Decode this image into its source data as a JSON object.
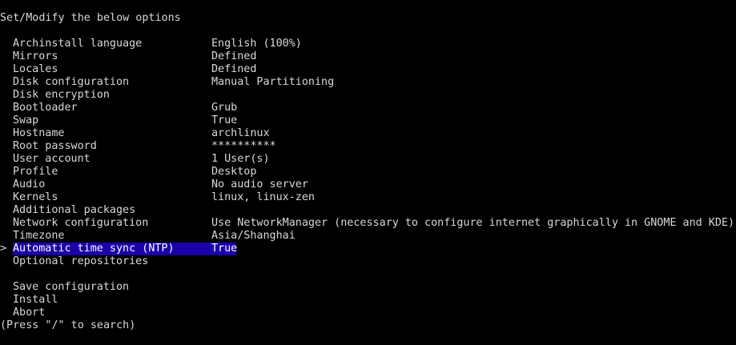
{
  "prompt": "Set/Modify the below options",
  "cursor_symbol": ">",
  "options": [
    {
      "label": "Archinstall language",
      "value": "English (100%)"
    },
    {
      "label": "Mirrors",
      "value": "Defined"
    },
    {
      "label": "Locales",
      "value": "Defined"
    },
    {
      "label": "Disk configuration",
      "value": "Manual Partitioning"
    },
    {
      "label": "Disk encryption",
      "value": ""
    },
    {
      "label": "Bootloader",
      "value": "Grub"
    },
    {
      "label": "Swap",
      "value": "True"
    },
    {
      "label": "Hostname",
      "value": "archlinux"
    },
    {
      "label": "Root password",
      "value": "**********"
    },
    {
      "label": "User account",
      "value": "1 User(s)"
    },
    {
      "label": "Profile",
      "value": "Desktop"
    },
    {
      "label": "Audio",
      "value": "No audio server"
    },
    {
      "label": "Kernels",
      "value": "linux, linux-zen"
    },
    {
      "label": "Additional packages",
      "value": ""
    },
    {
      "label": "Network configuration",
      "value": "Use NetworkManager (necessary to configure internet graphically in GNOME and KDE)"
    },
    {
      "label": "Timezone",
      "value": "Asia/Shanghai"
    },
    {
      "label": "Automatic time sync (NTP)",
      "value": "True"
    },
    {
      "label": "Optional repositories",
      "value": ""
    }
  ],
  "selected_index": 16,
  "actions": [
    {
      "label": "Save configuration"
    },
    {
      "label": "Install"
    },
    {
      "label": "Abort"
    }
  ],
  "footer": "(Press \"/\" to search)",
  "colors": {
    "background": "#000000",
    "text": "#d8d8d8",
    "highlight_bg": "#1a00a8",
    "highlight_text": "#ffffff"
  }
}
